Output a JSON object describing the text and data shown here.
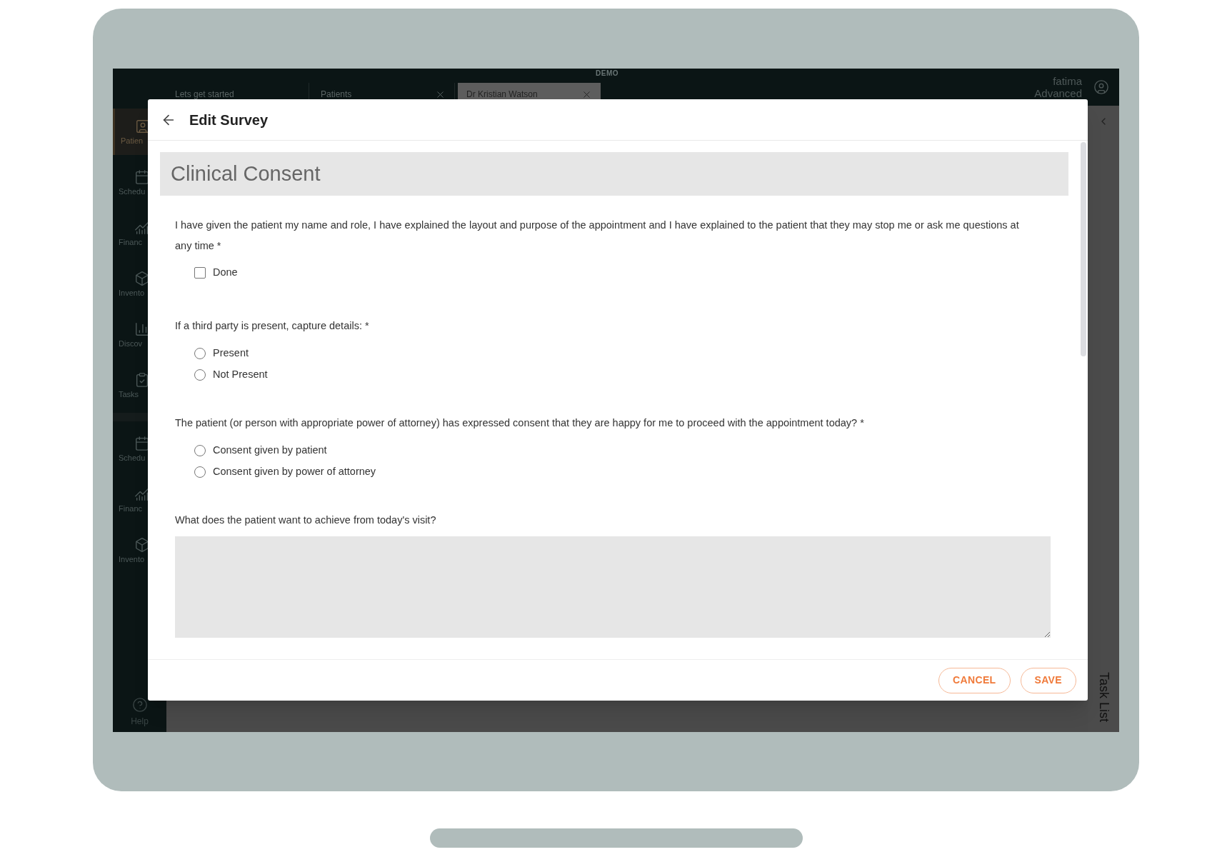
{
  "app": {
    "banner": "DEMO",
    "tabs": [
      {
        "label": "Lets get started",
        "selected": false,
        "closable": false
      },
      {
        "label": "Patients",
        "selected": false,
        "closable": true
      },
      {
        "label": "Dr Kristian Watson",
        "selected": true,
        "closable": true
      }
    ],
    "user": {
      "name": "fatima",
      "role": "Advanced"
    },
    "sidebar": {
      "groups": [
        [
          {
            "label": "Patien",
            "kind": "patient",
            "selected": true
          },
          {
            "label": "Schedu",
            "kind": "calendar",
            "selected": false
          },
          {
            "label": "Financ",
            "kind": "finance",
            "selected": false
          },
          {
            "label": "Invento",
            "kind": "box",
            "selected": false
          },
          {
            "label": "Discov",
            "kind": "bars",
            "selected": false
          },
          {
            "label": "Tasks",
            "kind": "tasks",
            "selected": false
          }
        ],
        [
          {
            "label": "Schedu",
            "kind": "calendar",
            "selected": false
          },
          {
            "label": "Financ",
            "kind": "finance",
            "selected": false
          },
          {
            "label": "Invento",
            "kind": "box",
            "selected": false
          }
        ]
      ],
      "help": "Help"
    },
    "task_panel": {
      "label": "Task List"
    }
  },
  "dialog": {
    "title": "Edit Survey",
    "section": "Clinical Consent",
    "questions": [
      {
        "kind": "checkbox",
        "text": "I have given the patient my name and role, I have explained the layout and purpose of the appointment and I have explained to the patient that they may stop me or ask me questions at any time *",
        "options": [
          {
            "label": "Done",
            "checked": false
          }
        ]
      },
      {
        "kind": "radio",
        "text": "If a third party is present, capture details: *",
        "options": [
          {
            "label": "Present",
            "selected": false
          },
          {
            "label": "Not Present",
            "selected": false
          }
        ]
      },
      {
        "kind": "radio",
        "text": "The patient (or person with appropriate power of attorney) has expressed consent that they are happy for me to proceed with the appointment today? *",
        "options": [
          {
            "label": "Consent given by patient",
            "selected": false
          },
          {
            "label": "Consent given by power of attorney",
            "selected": false
          }
        ]
      },
      {
        "kind": "textarea",
        "text": "What does the patient want to achieve from today's visit?"
      }
    ],
    "buttons": [
      {
        "label": "CANCEL"
      },
      {
        "label": "SAVE"
      }
    ]
  }
}
